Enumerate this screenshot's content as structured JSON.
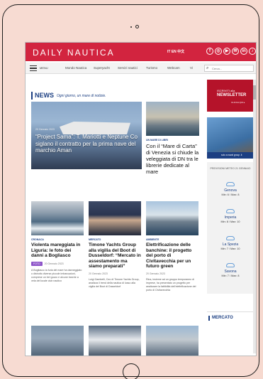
{
  "topbar": {
    "brand": "DAILY NAUTICA",
    "langs": "IT  EN  中文",
    "social": [
      "f",
      "◎",
      "▶",
      "✉",
      "in",
      "♪"
    ]
  },
  "navbar": {
    "menu_label": "MENU",
    "items": [
      "Mondo Nautica",
      "Superyacht",
      "Servizi nautici",
      "Turismo",
      "Webcam",
      "Vi"
    ],
    "search_placeholder": "Cerca..."
  },
  "news": {
    "title": "NEWS",
    "subtitle": "Ogni giorno, un mare di notizie."
  },
  "hero": {
    "date": "20 Gennaio 2023",
    "headline": "“Project Sama”: T. Mariotti e Neptune Co siglano il contratto per la prima nave del marchio Aman"
  },
  "side_story": {
    "category": "UN MARE DI LIBRI",
    "title": "Con il “Mare di Carta” di Venezia si chiude la veleggiata di DN tra le librerie dedicate al mare"
  },
  "cards": [
    {
      "category": "CRONACA",
      "title": "Violenta mareggiata in Liguria: le foto dei danni a Bogliasco",
      "badge": "FOTO",
      "meta": "20 Gennaio 2023",
      "excerpt": "A Bogliasco la furia del mare ha danneggiato o distrutto diverse piccole imbarcazioni, comprese un bel gozzo e alcune barche a vela del locale club nautico"
    },
    {
      "category": "MERCATO",
      "title": "Timone Yachts Group alla vigilia del Boot di Dusseldorf: “Mercato in assestamento ma siamo preparati”",
      "meta": "20 Gennaio 2023",
      "excerpt": "Luigi Gambelli, Ceo di Timone Yachts Group, analizza il trend della nautica di lusso alla vigilia del Boot di Dusseldorf"
    },
    {
      "category": "AMBIENTE",
      "title": "Elettrificazione delle banchine: il progetto del porto di Civitavecchia per un futuro green",
      "meta": "20 Gennaio 2023",
      "excerpt": "Rina, insieme ad un gruppo temporaneo di imprese, ha presentato un progetto per analizzare la fattibilità dell'elettrificazione del porto di Civitavecchia"
    }
  ],
  "sidebar": {
    "ad1": {
      "l1": "ISCRIVITI alla",
      "l2": "NEWSLETTER",
      "l3": "CLICCA QUI ▸"
    },
    "ad2_caption": "solo a naval group .it",
    "weather_title": "PREVISIONI METEO 21 GENNAIO",
    "cities": [
      {
        "name": "Genova",
        "temps": "Min: 6 / Max: 8"
      },
      {
        "name": "Imperia",
        "temps": "Min: 8 / Max: 10"
      },
      {
        "name": "La Spezia",
        "temps": "Min: 7 / Max: 10"
      },
      {
        "name": "Savona",
        "temps": "Min: 7 / Max: 8"
      }
    ],
    "mercato": "MERCATO"
  },
  "colors": {
    "brand_red": "#d2243f",
    "accent_blue": "#1c3f82",
    "badge_purple": "#8e55c9"
  }
}
